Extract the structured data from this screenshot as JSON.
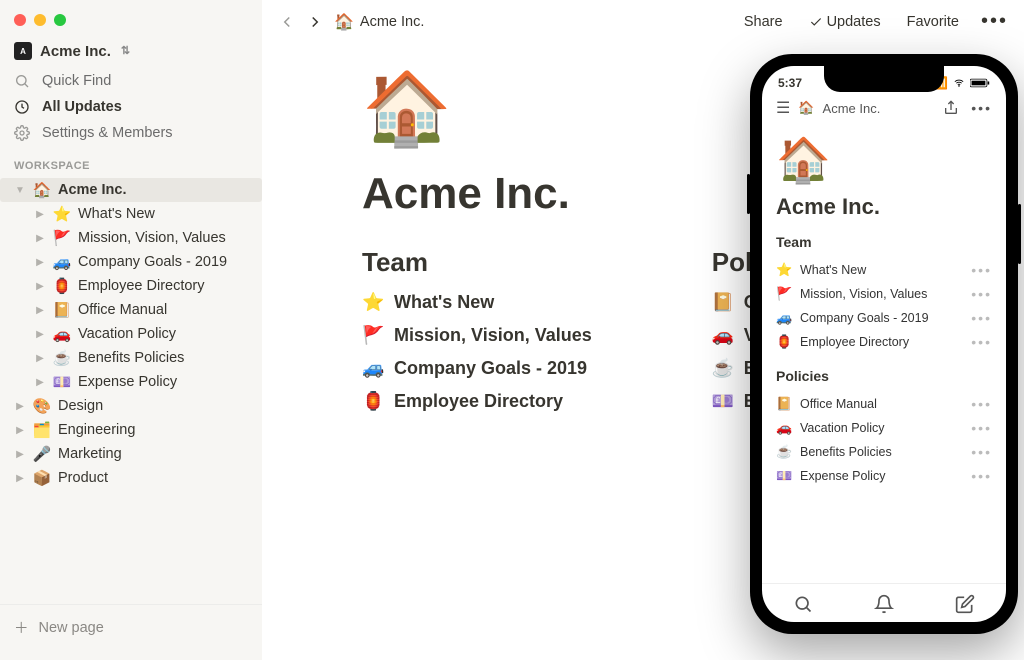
{
  "sidebar": {
    "workspace_name": "Acme Inc.",
    "quick_find": "Quick Find",
    "all_updates": "All Updates",
    "settings": "Settings & Members",
    "section": "WORKSPACE",
    "tree": {
      "root": {
        "emoji": "🏠",
        "label": "Acme Inc."
      },
      "children": [
        {
          "emoji": "⭐",
          "label": "What's New"
        },
        {
          "emoji": "🚩",
          "label": "Mission, Vision, Values"
        },
        {
          "emoji": "🚙",
          "label": "Company Goals - 2019"
        },
        {
          "emoji": "🏮",
          "label": "Employee Directory"
        },
        {
          "emoji": "📔",
          "label": "Office Manual"
        },
        {
          "emoji": "🚗",
          "label": "Vacation Policy"
        },
        {
          "emoji": "☕",
          "label": "Benefits Policies"
        },
        {
          "emoji": "💷",
          "label": "Expense Policy"
        }
      ],
      "siblings": [
        {
          "emoji": "🎨",
          "label": "Design"
        },
        {
          "emoji": "🗂️",
          "label": "Engineering"
        },
        {
          "emoji": "🎤",
          "label": "Marketing"
        },
        {
          "emoji": "📦",
          "label": "Product"
        }
      ]
    },
    "new_page": "New page"
  },
  "topbar": {
    "crumb": {
      "emoji": "🏠",
      "label": "Acme Inc."
    },
    "share": "Share",
    "updates": "Updates",
    "favorite": "Favorite"
  },
  "page": {
    "icon": "🏠",
    "title": "Acme Inc.",
    "team_h": "Team",
    "policies_h": "Policies",
    "team": [
      {
        "emoji": "⭐",
        "label": "What's New"
      },
      {
        "emoji": "🚩",
        "label": "Mission, Vision, Values"
      },
      {
        "emoji": "🚙",
        "label": "Company Goals - 2019"
      },
      {
        "emoji": "🏮",
        "label": "Employee Directory"
      }
    ],
    "policies": [
      {
        "emoji": "📔",
        "label": "Office Manual"
      },
      {
        "emoji": "🚗",
        "label": "Vacation Policy"
      },
      {
        "emoji": "☕",
        "label": "Benefits Policies"
      },
      {
        "emoji": "💷",
        "label": "Expense Policy"
      }
    ]
  },
  "phone": {
    "time": "5:37",
    "crumb": {
      "emoji": "🏠",
      "label": "Acme Inc."
    },
    "icon": "🏠",
    "title": "Acme Inc.",
    "team_h": "Team",
    "policies_h": "Policies",
    "team": [
      {
        "emoji": "⭐",
        "label": "What's New"
      },
      {
        "emoji": "🚩",
        "label": "Mission, Vision, Values"
      },
      {
        "emoji": "🚙",
        "label": "Company Goals - 2019"
      },
      {
        "emoji": "🏮",
        "label": "Employee Directory"
      }
    ],
    "policies": [
      {
        "emoji": "📔",
        "label": "Office Manual"
      },
      {
        "emoji": "🚗",
        "label": "Vacation Policy"
      },
      {
        "emoji": "☕",
        "label": "Benefits Policies"
      },
      {
        "emoji": "💷",
        "label": "Expense Policy"
      }
    ]
  }
}
